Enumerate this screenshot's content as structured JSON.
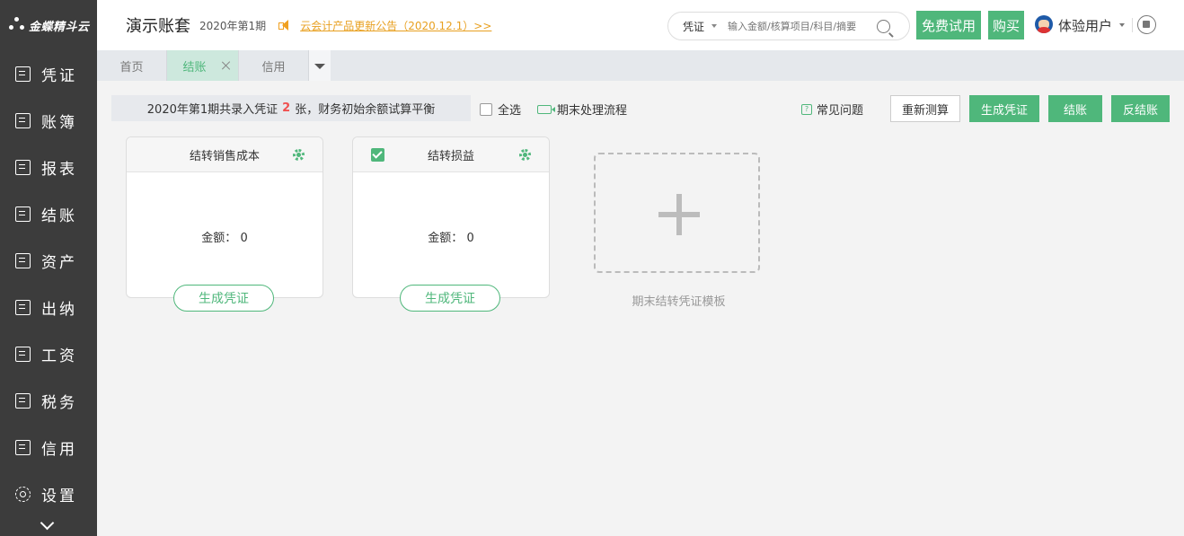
{
  "app": {
    "logo_text": "金蝶精斗云"
  },
  "sidebar": {
    "items": [
      {
        "label": "凭证",
        "icon": "voucher-icon"
      },
      {
        "label": "账簿",
        "icon": "ledger-icon"
      },
      {
        "label": "报表",
        "icon": "report-icon"
      },
      {
        "label": "结账",
        "icon": "closing-icon"
      },
      {
        "label": "资产",
        "icon": "asset-icon"
      },
      {
        "label": "出纳",
        "icon": "cashier-icon"
      },
      {
        "label": "工资",
        "icon": "salary-icon"
      },
      {
        "label": "税务",
        "icon": "tax-icon"
      },
      {
        "label": "信用",
        "icon": "credit-icon"
      },
      {
        "label": "设置",
        "icon": "gear-icon"
      }
    ]
  },
  "header": {
    "account_title": "演示账套",
    "period": "2020年第1期",
    "notice": "云会计产品更新公告（2020.12.1）>>",
    "search_type": "凭证",
    "search_placeholder": "输入金额/核算项目/科目/摘要",
    "trial_label": "免费试用",
    "buy_label": "购买",
    "user_name": "体验用户"
  },
  "tabs": [
    {
      "label": "首页",
      "active": false
    },
    {
      "label": "结账",
      "active": true
    },
    {
      "label": "信用",
      "active": false
    }
  ],
  "toolbar": {
    "summary_prefix": "2020年第1期共录入凭证",
    "summary_count": "2",
    "summary_suffix": "张，财务初始余额试算平衡",
    "select_all": "全选",
    "flow_link": "期末处理流程",
    "faq": "常见问题",
    "faq_icon_text": "?",
    "recalc": "重新测算",
    "gen_voucher": "生成凭证",
    "close": "结账",
    "unclose": "反结账"
  },
  "cards": [
    {
      "title": "结转销售成本",
      "amount_label": "金额：",
      "amount": "0",
      "button": "生成凭证",
      "checked": false
    },
    {
      "title": "结转损益",
      "amount_label": "金额：",
      "amount": "0",
      "button": "生成凭证",
      "checked": true
    }
  ],
  "template_card": {
    "label": "期末结转凭证模板"
  },
  "colors": {
    "accent": "#4fb77b",
    "sidebar_bg": "#3c3c3c",
    "notice": "#e8a020",
    "highlight": "#f05050"
  }
}
